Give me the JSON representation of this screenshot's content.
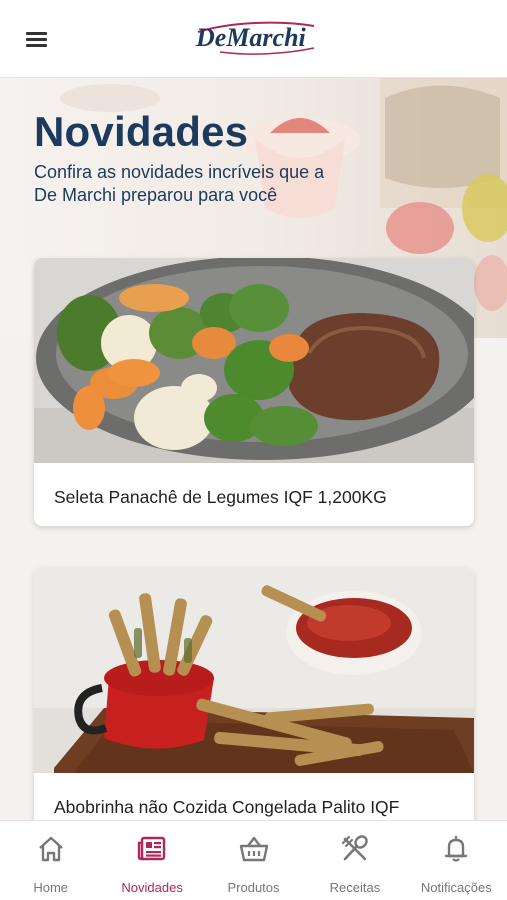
{
  "header": {
    "logo_text": "DeMarchi",
    "menu_icon": "hamburger-menu-icon"
  },
  "hero": {
    "title": "Novidades",
    "subtitle": "Confira as novidades incríveis que a De Marchi preparou para você"
  },
  "products": [
    {
      "name": "Seleta Panachê de Legumes IQF 1,200KG",
      "image": "vegetables-and-steak-plate"
    },
    {
      "name": "Abobrinha não Cozida  Congelada Palito IQF",
      "image": "breaded-zucchini-sticks-with-sauce"
    }
  ],
  "bottom_nav": {
    "items": [
      {
        "label": "Home",
        "icon": "home-icon",
        "active": false
      },
      {
        "label": "Novidades",
        "icon": "news-icon",
        "active": true
      },
      {
        "label": "Produtos",
        "icon": "basket-icon",
        "active": false
      },
      {
        "label": "Receitas",
        "icon": "fork-spoon-icon",
        "active": false
      },
      {
        "label": "Notificações",
        "icon": "bell-icon",
        "active": false
      }
    ]
  },
  "colors": {
    "brand_navy": "#1d3a5c",
    "active_nav": "#b0285a",
    "inactive_nav": "#777777"
  }
}
